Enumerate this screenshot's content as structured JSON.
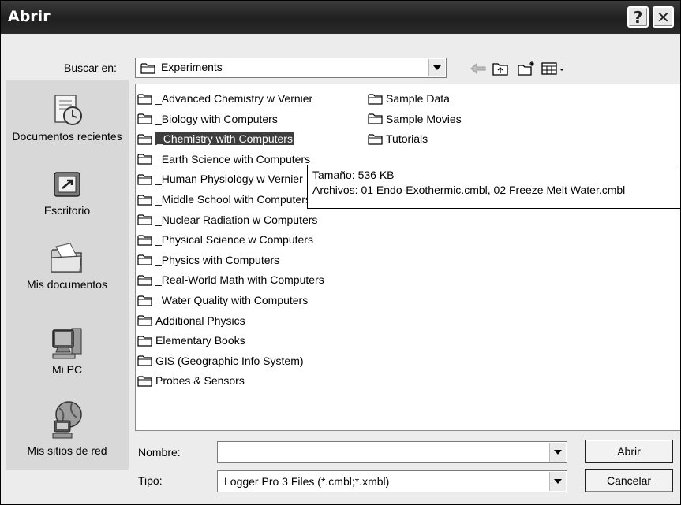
{
  "window": {
    "title": "Abrir",
    "help_glyph": "?",
    "close_glyph": "✕"
  },
  "lookin": {
    "label": "Buscar en:",
    "value": "Experiments"
  },
  "places": [
    {
      "label": "Documentos recientes",
      "icon": "recent-documents-icon"
    },
    {
      "label": "Escritorio",
      "icon": "desktop-icon"
    },
    {
      "label": "Mis documentos",
      "icon": "my-documents-icon"
    },
    {
      "label": "Mi PC",
      "icon": "my-computer-icon"
    },
    {
      "label": "Mis sitios de red",
      "icon": "network-places-icon"
    }
  ],
  "files_col1": [
    "_Advanced Chemistry w Vernier",
    "_Biology with Computers",
    "_Chemistry with Computers",
    "_Earth Science with Computers",
    "_Human Physiology w Vernier",
    "_Middle School with Computers",
    "_Nuclear Radiation w Computers",
    "_Physical Science w Computers",
    "_Physics with Computers",
    "_Real-World Math with Computers",
    "_Water Quality with Computers",
    "Additional Physics",
    "Elementary Books",
    "GIS (Geographic Info System)",
    "Probes & Sensors"
  ],
  "files_col2": [
    "Sample Data",
    "Sample Movies",
    "Tutorials"
  ],
  "selected_file": "_Chemistry with Computers",
  "tooltip": {
    "line1": "Tamaño: 536 KB",
    "line2": "Archivos: 01 Endo-Exothermic.cmbl, 02 Freeze Melt Water.cmbl"
  },
  "filename": {
    "label": "Nombre:",
    "value": ""
  },
  "filetype": {
    "label": "Tipo:",
    "value": "Logger Pro 3 Files (*.cmbl;*.xmbl)"
  },
  "buttons": {
    "open": "Abrir",
    "cancel": "Cancelar"
  },
  "colors": {
    "titlebar": "#2b2b2b",
    "selection": "#3e3e3e",
    "places_bg": "#d8d8d8"
  }
}
